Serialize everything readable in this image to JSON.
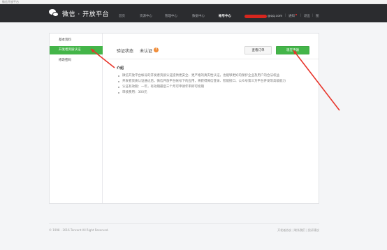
{
  "browser": {
    "tab_label": "微信开放平台"
  },
  "header": {
    "logo_text": "微信 · 开放平台",
    "nav": [
      "首页",
      "资源中心",
      "管理中心",
      "数据中心",
      "帐号中心"
    ],
    "active_nav_index": 4,
    "email_suffix": "@qq.com",
    "links": {
      "notify": "通知",
      "logout": "退出",
      "extra": "图"
    }
  },
  "sidebar": {
    "items": [
      "基本资料",
      "开发者资质认证",
      "修改密码"
    ],
    "active_index": 1
  },
  "status": {
    "label": "验证状态",
    "value": "未认证",
    "warn_icon_glyph": "!"
  },
  "buttons": {
    "order": "查看订单",
    "apply": "现在申请"
  },
  "intro": {
    "title": "介绍",
    "bullets": [
      "微信开放平台帐号的开发者资质认证提供更安全、更严格的真实性认证，也能够更好的保护企业及用户的合法权益",
      "开发者资质认证通过后，微信开放平台帐号下的应用，将获得微信登录、智能接口、公众号第三方平台开发等高级能力",
      "认证有效期：一年，有效期最后三个月可申请年审即可续期",
      "审核费用：300元"
    ]
  },
  "footer": {
    "copyright": "© 1998 - 2016 Tencent All Right Reserved.",
    "links": [
      "开发者协议",
      "联系我们",
      "投诉建议"
    ]
  },
  "colors": {
    "accent_green": "#44b549",
    "header_bg": "#2b2c2f",
    "annotation_red": "#e8352b"
  }
}
